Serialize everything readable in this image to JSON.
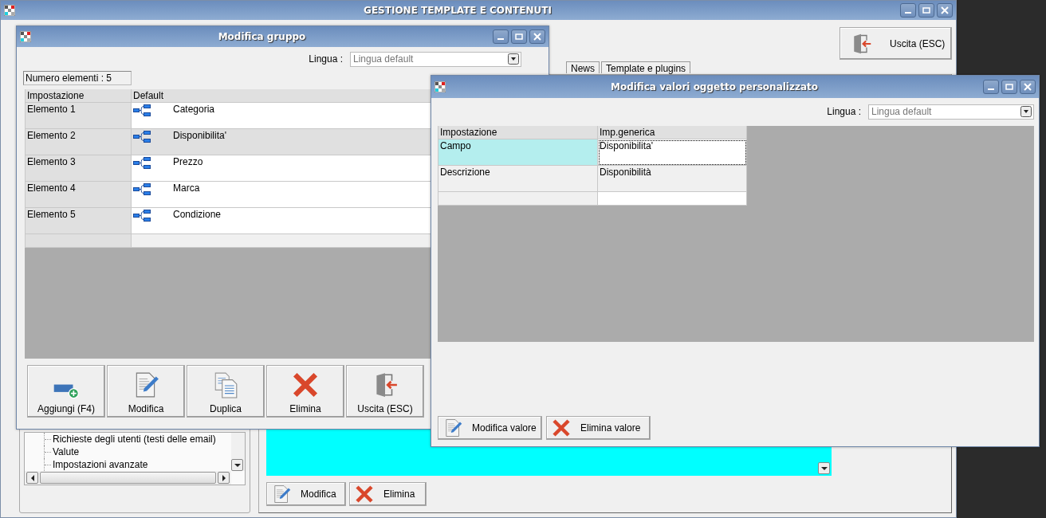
{
  "main_window": {
    "title": "GESTIONE TEMPLATE E CONTENUTI",
    "exit_button": "Uscita (ESC)",
    "tabs": [
      {
        "label": "News"
      },
      {
        "label": "Template e plugins"
      }
    ],
    "tree": {
      "items": [
        "Richieste degli utenti (testi delle email)",
        "Valute",
        "Impostazioni avanzate"
      ]
    },
    "buttons": [
      {
        "label": "Modifica",
        "kind": "edit"
      },
      {
        "label": "Elimina",
        "kind": "delete"
      }
    ]
  },
  "group_dialog": {
    "title": "Modifica gruppo",
    "language_label": "Lingua :",
    "language_value": "Lingua default",
    "count": "Numero elementi : 5",
    "table": {
      "columns": [
        "Impostazione",
        "Default"
      ],
      "rows": [
        {
          "setting": "Elemento 1",
          "value": "Categoria",
          "selected": false
        },
        {
          "setting": "Elemento 2",
          "value": "Disponibilita'",
          "selected": true
        },
        {
          "setting": "Elemento 3",
          "value": "Prezzo",
          "selected": false
        },
        {
          "setting": "Elemento 4",
          "value": "Marca",
          "selected": false
        },
        {
          "setting": "Elemento 5",
          "value": "Condizione",
          "selected": false
        }
      ]
    },
    "buttons": [
      {
        "label": "Aggiungi (F4)",
        "kind": "add"
      },
      {
        "label": "Modifica",
        "kind": "edit"
      },
      {
        "label": "Duplica",
        "kind": "duplicate"
      },
      {
        "label": "Elimina",
        "kind": "delete"
      },
      {
        "label": "Uscita (ESC)",
        "kind": "exit"
      }
    ]
  },
  "values_dialog": {
    "title": "Modifica valori oggetto personalizzato",
    "language_label": "Lingua :",
    "language_value": "Lingua default",
    "table": {
      "columns": [
        "Impostazione",
        "Imp.generica"
      ],
      "rows": [
        {
          "setting": "Campo",
          "value": "Disponibilita'",
          "selected": true
        },
        {
          "setting": "Descrizione",
          "value": "Disponibilità",
          "selected": false
        }
      ]
    },
    "buttons": [
      {
        "label": "Modifica valore",
        "kind": "edit"
      },
      {
        "label": "Elimina valore",
        "kind": "delete"
      }
    ]
  }
}
